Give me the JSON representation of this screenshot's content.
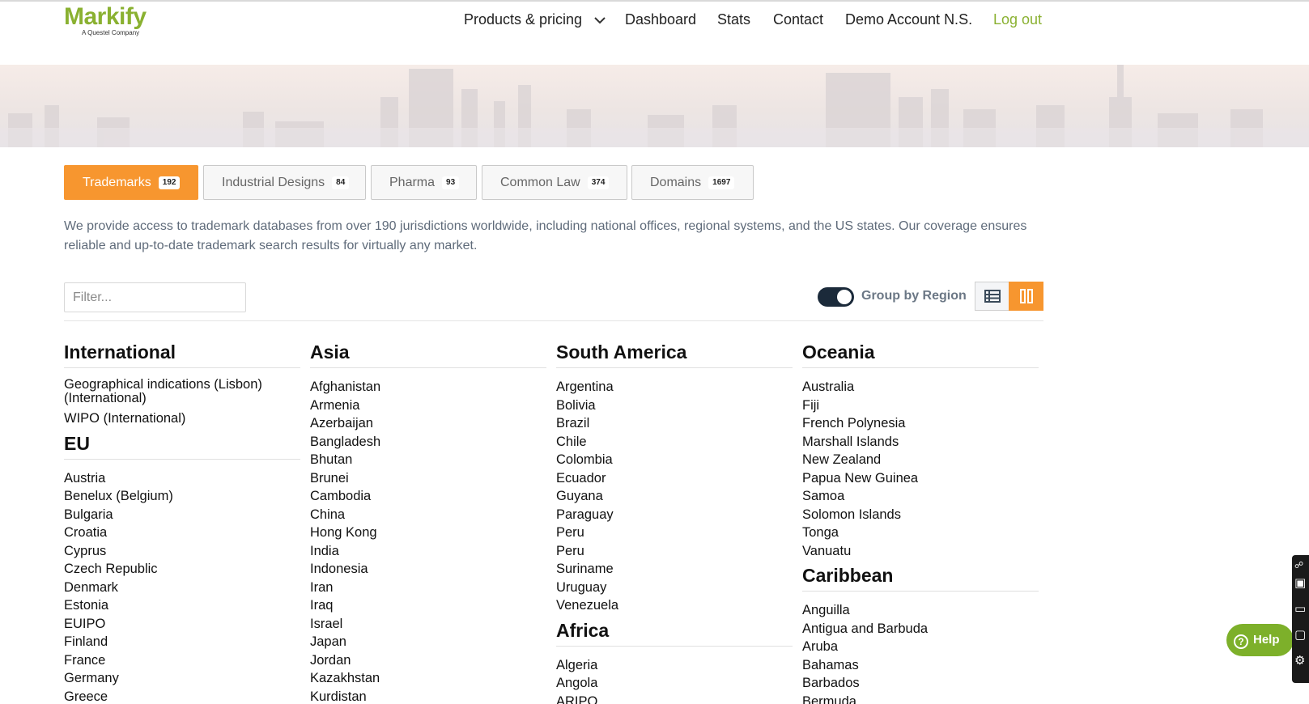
{
  "header": {
    "logo": "Markify",
    "logo_sub": "A Questel Company",
    "nav": [
      {
        "label": "Products & pricing",
        "has_dropdown": true
      },
      {
        "label": "Dashboard"
      },
      {
        "label": "Stats"
      },
      {
        "label": "Contact"
      },
      {
        "label": "Demo Account N.S."
      },
      {
        "label": "Log out"
      }
    ]
  },
  "tabs": [
    {
      "label": "Trademarks",
      "count": "192",
      "active": true
    },
    {
      "label": "Industrial Designs",
      "count": "84"
    },
    {
      "label": "Pharma",
      "count": "93"
    },
    {
      "label": "Common Law",
      "count": "374"
    },
    {
      "label": "Domains",
      "count": "1697"
    }
  ],
  "description": "We provide access to trademark databases from over 190 jurisdictions worldwide, including national offices, regional systems, and the US states. Our coverage ensures reliable and up-to-date trademark search results for virtually any market.",
  "filter": {
    "placeholder": "Filter...",
    "value": ""
  },
  "group_by_region": {
    "label": "Group by Region",
    "enabled": true
  },
  "view_mode": "columns",
  "columns": [
    [
      {
        "title": "International",
        "items": [
          "Geographical indications (Lisbon) (International)",
          "WIPO (International)"
        ]
      },
      {
        "title": "EU",
        "items": [
          "Austria",
          "Benelux (Belgium)",
          "Bulgaria",
          "Croatia",
          "Cyprus",
          "Czech Republic",
          "Denmark",
          "Estonia",
          "EUIPO",
          "Finland",
          "France",
          "Germany",
          "Greece"
        ]
      }
    ],
    [
      {
        "title": "Asia",
        "items": [
          "Afghanistan",
          "Armenia",
          "Azerbaijan",
          "Bangladesh",
          "Bhutan",
          "Brunei",
          "Cambodia",
          "China",
          "Hong Kong",
          "India",
          "Indonesia",
          "Iran",
          "Iraq",
          "Israel",
          "Japan",
          "Jordan",
          "Kazakhstan",
          "Kurdistan"
        ]
      }
    ],
    [
      {
        "title": "South America",
        "items": [
          "Argentina",
          "Bolivia",
          "Brazil",
          "Chile",
          "Colombia",
          "Ecuador",
          "Guyana",
          "Paraguay",
          "Peru",
          "Peru",
          "Suriname",
          "Uruguay",
          "Venezuela"
        ]
      },
      {
        "title": "Africa",
        "items": [
          "Algeria",
          "Angola",
          "ARIPO"
        ]
      }
    ],
    [
      {
        "title": "Oceania",
        "items": [
          "Australia",
          "Fiji",
          "French Polynesia",
          "Marshall Islands",
          "New Zealand",
          "Papua New Guinea",
          "Samoa",
          "Solomon Islands",
          "Tonga",
          "Vanuatu"
        ]
      },
      {
        "title": "Caribbean",
        "items": [
          "Anguilla",
          "Antigua and Barbuda",
          "Aruba",
          "Bahamas",
          "Barbados",
          "Bermuda"
        ]
      }
    ]
  ],
  "help_button": "Help",
  "colors": {
    "accent": "#f7962f",
    "brand_green": "#8ab131",
    "toggle": "#1b2a3a",
    "help_green": "#7db02a"
  }
}
